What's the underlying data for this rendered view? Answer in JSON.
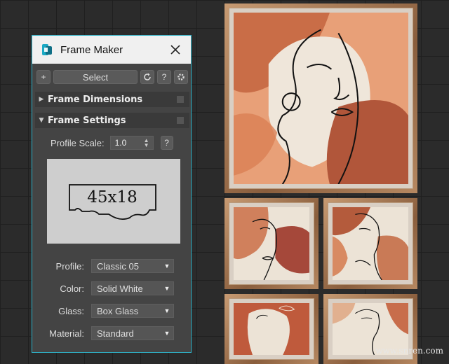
{
  "window": {
    "title": "Frame Maker",
    "icons": {
      "app": "frame-maker-logo-icon",
      "close": "close-icon"
    }
  },
  "toolbar": {
    "add_label": "+",
    "select_label": "Select",
    "refresh_icon": "refresh-icon",
    "help_label": "?",
    "settings_icon": "gear-icon"
  },
  "rollouts": {
    "frame_dimensions": "Frame Dimensions",
    "frame_settings": "Frame Settings"
  },
  "settings": {
    "profile_scale_label": "Profile Scale:",
    "profile_scale_value": "1.0",
    "help_label": "?",
    "preview_text": "45x18",
    "fields": [
      {
        "label": "Profile:",
        "value": "Classic 05"
      },
      {
        "label": "Color:",
        "value": "Solid White"
      },
      {
        "label": "Glass:",
        "value": "Box Glass"
      },
      {
        "label": "Material:",
        "value": "Standard"
      }
    ]
  },
  "watermark": "www.snren.com",
  "colors": {
    "accent_border": "#2fb3c8",
    "panel_bg": "#444444",
    "frame_wood": "#a67b56",
    "art_rust": "#b9603c",
    "art_peach": "#e7a27a",
    "art_cream": "#ece3d6"
  }
}
